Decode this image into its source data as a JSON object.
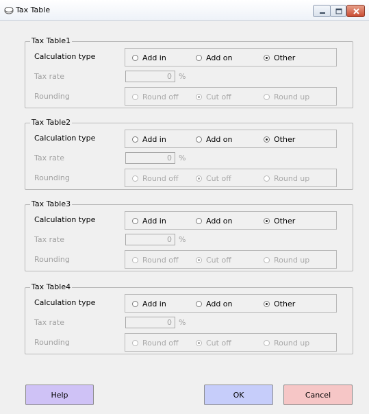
{
  "window": {
    "title": "Tax Table"
  },
  "labels": {
    "calculation_type": "Calculation type",
    "tax_rate": "Tax rate",
    "rounding": "Rounding",
    "percent": "%"
  },
  "calculation_options": [
    "Add in",
    "Add on",
    "Other"
  ],
  "rounding_options": [
    "Round off",
    "Cut off",
    "Round up"
  ],
  "tables": [
    {
      "title": "Tax Table1",
      "calculation_selected": "Other",
      "tax_rate": "0",
      "rounding_selected": "Cut off"
    },
    {
      "title": "Tax Table2",
      "calculation_selected": "Other",
      "tax_rate": "0",
      "rounding_selected": "Cut off"
    },
    {
      "title": "Tax Table3",
      "calculation_selected": "Other",
      "tax_rate": "0",
      "rounding_selected": "Cut off"
    },
    {
      "title": "Tax Table4",
      "calculation_selected": "Other",
      "tax_rate": "0",
      "rounding_selected": "Cut off"
    }
  ],
  "buttons": {
    "help": "Help",
    "ok": "OK",
    "cancel": "Cancel"
  },
  "colors": {
    "help": "#cfc2f6",
    "ok": "#c6cdfa",
    "cancel": "#f6c6c6"
  }
}
